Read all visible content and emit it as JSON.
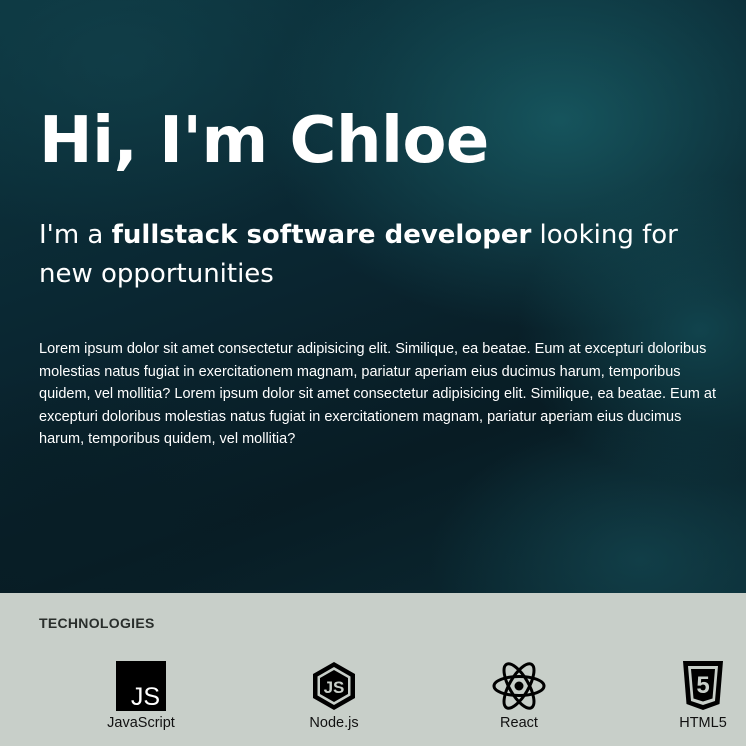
{
  "hero": {
    "title": "Hi, I'm Chloe",
    "subtitle_prefix": "I'm a ",
    "subtitle_bold": "fullstack software developer",
    "subtitle_suffix": " looking for new opportunities",
    "body": "Lorem ipsum dolor sit amet consectetur adipisicing elit. Similique, ea beatae. Eum at excepturi doloribus molestias natus fugiat in exercitationem magnam, pariatur aperiam eius ducimus harum, temporibus quidem, vel mollitia? Lorem ipsum dolor sit amet consectetur adipisicing elit. Similique, ea beatae. Eum at excepturi doloribus molestias natus fugiat in exercitationem magnam, pariatur aperiam eius ducimus harum, temporibus quidem, vel mollitia?"
  },
  "technologies": {
    "heading": "TECHNOLOGIES",
    "items": [
      {
        "label": "JavaScript",
        "icon": "javascript-icon",
        "logo_text": "JS"
      },
      {
        "label": "Node.js",
        "icon": "nodejs-icon",
        "logo_text": "JS"
      },
      {
        "label": "React",
        "icon": "react-icon"
      },
      {
        "label": "HTML5",
        "icon": "html5-icon",
        "logo_text": "5"
      }
    ]
  },
  "colors": {
    "hero_background": "#0a2530",
    "section_background": "#c8cfc9",
    "text_light": "#ffffff",
    "text_dark": "#111111"
  }
}
